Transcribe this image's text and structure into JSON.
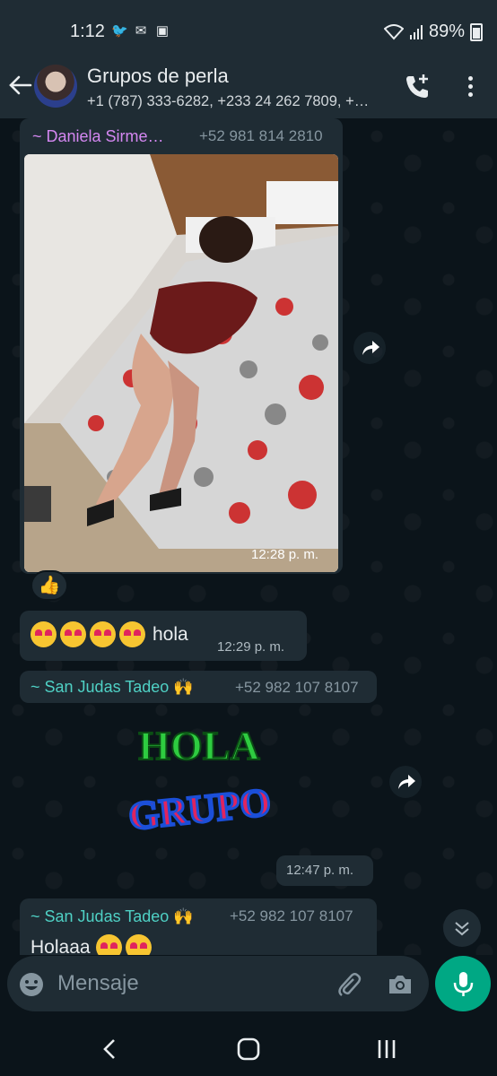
{
  "status_bar": {
    "time": "1:12",
    "battery": "89%"
  },
  "header": {
    "title": "Grupos de perla",
    "subtitle": "+1 (787) 333-6282, +233 24 262 7809, +…"
  },
  "messages": [
    {
      "sender": "~ Daniela Sirme…",
      "phone": "+52 981 814 2810",
      "time": "12:28 p. m.",
      "reaction": "👍"
    },
    {
      "text": "hola",
      "time": "12:29 p. m."
    },
    {
      "sender": "~ San Judas Tadeo 🙌",
      "phone": "+52 982 107 8107"
    },
    {
      "sticker_top": "HOLA",
      "sticker_bottom": "GRUPO",
      "time": "12:47 p. m."
    },
    {
      "sender": "~ San Judas Tadeo 🙌",
      "phone": "+52 982 107 8107",
      "text": "Holaaa"
    }
  ],
  "composer": {
    "placeholder": "Mensaje"
  },
  "colors": {
    "accent": "#00a884",
    "bubble": "#1f2c34",
    "header": "#1f2c34",
    "background": "#0b141a"
  }
}
